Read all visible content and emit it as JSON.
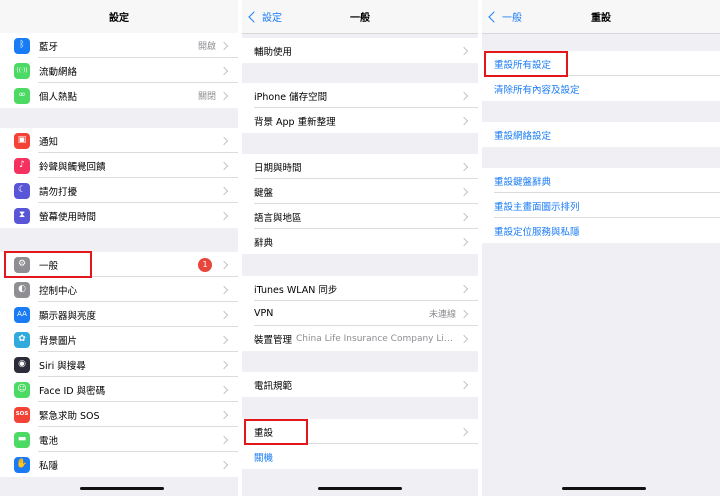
{
  "panel1": {
    "title": "設定",
    "rows": [
      {
        "label": "藍牙",
        "value": "開啟"
      },
      {
        "label": "流動網絡",
        "value": ""
      },
      {
        "label": "個人熱點",
        "value": "關閉"
      },
      {
        "label": "通知",
        "value": ""
      },
      {
        "label": "鈴聲與觸覺回饋",
        "value": ""
      },
      {
        "label": "請勿打擾",
        "value": ""
      },
      {
        "label": "螢幕使用時間",
        "value": ""
      },
      {
        "label": "一般",
        "badge": "1"
      },
      {
        "label": "控制中心"
      },
      {
        "label": "顯示器與亮度"
      },
      {
        "label": "背景圖片"
      },
      {
        "label": "Siri 與搜尋"
      },
      {
        "label": "Face ID 與密碼"
      },
      {
        "label": "緊急求助 SOS"
      },
      {
        "label": "電池"
      },
      {
        "label": "私隱"
      }
    ],
    "icons": [
      {
        "name": "bluetooth-icon",
        "color": "#1a7cf5",
        "glyph": "ᛒ"
      },
      {
        "name": "cellular-icon",
        "color": "#4cd964",
        "glyph": "((·))"
      },
      {
        "name": "hotspot-icon",
        "color": "#4cd964",
        "glyph": "∞"
      },
      {
        "name": "notifications-icon",
        "color": "#f44336",
        "glyph": "▣"
      },
      {
        "name": "sounds-icon",
        "color": "#f5325f",
        "glyph": "♪"
      },
      {
        "name": "do-not-disturb-icon",
        "color": "#5856d6",
        "glyph": "☾"
      },
      {
        "name": "screen-time-icon",
        "color": "#5856d6",
        "glyph": "⧗"
      },
      {
        "name": "gear-icon",
        "color": "#8e8e93",
        "glyph": "⚙"
      },
      {
        "name": "control-center-icon",
        "color": "#8e8e93",
        "glyph": "◐"
      },
      {
        "name": "display-icon",
        "color": "#1a7cf5",
        "glyph": "AA"
      },
      {
        "name": "wallpaper-icon",
        "color": "#30aadc",
        "glyph": "✿"
      },
      {
        "name": "siri-icon",
        "color": "#2b2b3a",
        "glyph": "◉"
      },
      {
        "name": "face-id-icon",
        "color": "#4cd964",
        "glyph": "☺"
      },
      {
        "name": "sos-icon",
        "color": "#f44336",
        "glyph": "SOS"
      },
      {
        "name": "battery-icon",
        "color": "#4cd964",
        "glyph": "▬"
      },
      {
        "name": "privacy-icon",
        "color": "#1a7cf5",
        "glyph": "✋"
      }
    ]
  },
  "panel2": {
    "back": "設定",
    "title": "一般",
    "rows": [
      {
        "label": "輔助使用"
      },
      {
        "label": "iPhone 儲存空間"
      },
      {
        "label": "背景 App 重新整理"
      },
      {
        "label": "日期與時間"
      },
      {
        "label": "鍵盤"
      },
      {
        "label": "語言與地區"
      },
      {
        "label": "辭典"
      },
      {
        "label": "iTunes WLAN 同步"
      },
      {
        "label": "VPN",
        "value": "未連線"
      },
      {
        "label": "裝置管理",
        "value": "China Life Insurance Company Lim..."
      },
      {
        "label": "電訊規範"
      },
      {
        "label": "重設"
      },
      {
        "label": "關機"
      }
    ]
  },
  "panel3": {
    "back": "一般",
    "title": "重設",
    "rows": [
      {
        "label": "重設所有設定"
      },
      {
        "label": "清除所有內容及設定"
      },
      {
        "label": "重設網絡設定"
      },
      {
        "label": "重設鍵盤辭典"
      },
      {
        "label": "重設主畫面圖示排列"
      },
      {
        "label": "重設定位服務與私隱"
      }
    ]
  },
  "colors": {
    "accent_blue": "#1a7cf5",
    "highlight_red": "#e3161c",
    "badge_red": "#e8453b",
    "group_bg": "#efeff4"
  }
}
